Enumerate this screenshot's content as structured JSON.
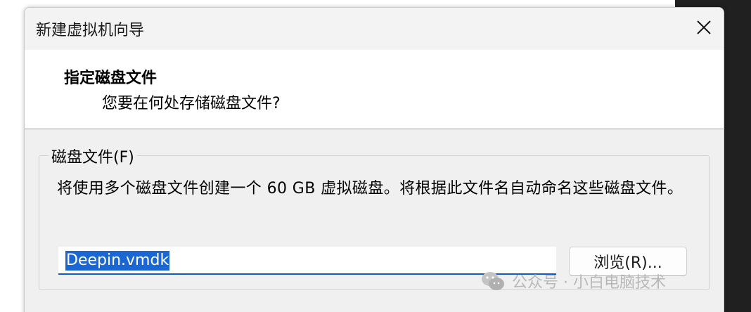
{
  "window": {
    "title": "新建虚拟机向导",
    "close_glyph": "✕"
  },
  "header": {
    "title": "指定磁盘文件",
    "subtitle": "您要在何处存储磁盘文件?"
  },
  "disk_file_group": {
    "legend": "磁盘文件(F)",
    "description": "将使用多个磁盘文件创建一个 60 GB 虚拟磁盘。将根据此文件名自动命名这些磁盘文件。",
    "filename_value": "Deepin.vmdk",
    "browse_label": "浏览(R)..."
  },
  "watermark": {
    "text": "公众号 · 小白电脑技术",
    "icon": "wechat-icon"
  },
  "colors": {
    "selection": "#1a66d2",
    "input_focus": "#0a5fc4",
    "watermark": "#b8b8b8"
  }
}
